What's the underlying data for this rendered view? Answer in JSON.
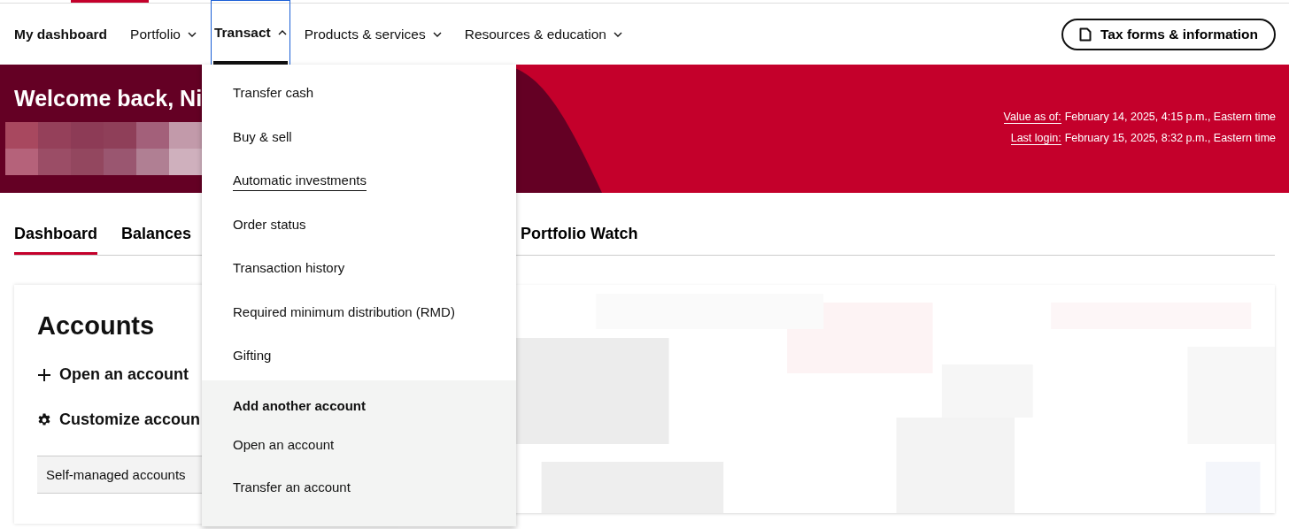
{
  "top_nav": {
    "items": [
      {
        "label": "My dashboard",
        "kind": "link",
        "expanded": false
      },
      {
        "label": "Portfolio",
        "kind": "menu",
        "expanded": false
      },
      {
        "label": "Transact",
        "kind": "menu",
        "expanded": true
      },
      {
        "label": "Products & services",
        "kind": "menu",
        "expanded": false
      },
      {
        "label": "Resources & education",
        "kind": "menu",
        "expanded": false
      }
    ],
    "tax_button": {
      "label": "Tax forms & information"
    }
  },
  "banner": {
    "greeting": "Welcome back, Ni",
    "info": [
      {
        "label": "Value as of:",
        "value": "February 14, 2025, 4:15 p.m., Eastern time"
      },
      {
        "label": "Last login:",
        "value": "February 15, 2025, 8:32 p.m., Eastern time"
      }
    ]
  },
  "tabs": [
    {
      "label": "Dashboard",
      "selected": true
    },
    {
      "label": "Balances",
      "selected": false
    },
    {
      "label": "Portfolio Watch",
      "selected": false
    }
  ],
  "accounts": {
    "title": "Accounts",
    "actions": [
      {
        "label": "Open an account",
        "kind": "add"
      },
      {
        "label": "Customize accoun",
        "kind": "customize"
      }
    ],
    "group_header": "Self-managed accounts"
  },
  "dropdown": {
    "items": [
      {
        "label": "Transfer cash",
        "hovered": false
      },
      {
        "label": "Buy & sell",
        "hovered": false
      },
      {
        "label": "Automatic investments",
        "hovered": true
      },
      {
        "label": "Order status",
        "hovered": false
      },
      {
        "label": "Transaction history",
        "hovered": false
      },
      {
        "label": "Required minimum distribution (RMD)",
        "hovered": false
      },
      {
        "label": "Gifting",
        "hovered": false
      }
    ],
    "section": {
      "heading": "Add another account",
      "items": [
        {
          "label": "Open an account",
          "hovered": false
        },
        {
          "label": "Transfer an account",
          "hovered": false
        }
      ]
    }
  }
}
